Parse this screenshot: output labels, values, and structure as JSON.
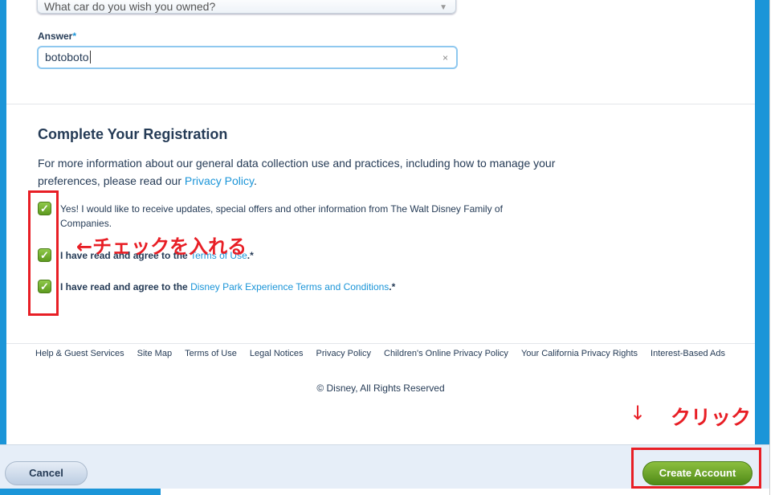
{
  "security": {
    "question_value": "What car do you wish you owned?",
    "answer_label": "Answer",
    "required_mark": "*",
    "answer_value": "botoboto",
    "clear_icon": "×"
  },
  "registration": {
    "title": "Complete Your Registration",
    "info_text": "For more information about our general data collection use and practices, including how to manage your preferences, please read our ",
    "privacy_link": "Privacy Policy",
    "info_end": ".",
    "checkboxes": [
      {
        "checked": true,
        "text": "Yes! I would like to receive updates, special offers and other information from The Walt Disney Family of Companies.",
        "link": "",
        "suffix": ""
      },
      {
        "checked": true,
        "text": "I have read and agree to the ",
        "link": "Terms of Use",
        "suffix": ".*"
      },
      {
        "checked": true,
        "text": "I have read and agree to the ",
        "link": "Disney Park Experience Terms and Conditions",
        "suffix": ".*"
      }
    ]
  },
  "footer": {
    "links": [
      "Help & Guest Services",
      "Site Map",
      "Terms of Use",
      "Legal Notices",
      "Privacy Policy",
      "Children's Online Privacy Policy",
      "Your California Privacy Rights",
      "Interest-Based Ads"
    ],
    "copyright": "© Disney, All Rights Reserved"
  },
  "actions": {
    "cancel": "Cancel",
    "create": "Create Account"
  },
  "annotations": {
    "check": "←チェックを入れる",
    "click_arrow": "↓",
    "click": "クリック"
  },
  "colors": {
    "accent": "#1b95d8",
    "annotation": "#e81e25",
    "create_button": "#5d9a1f"
  }
}
